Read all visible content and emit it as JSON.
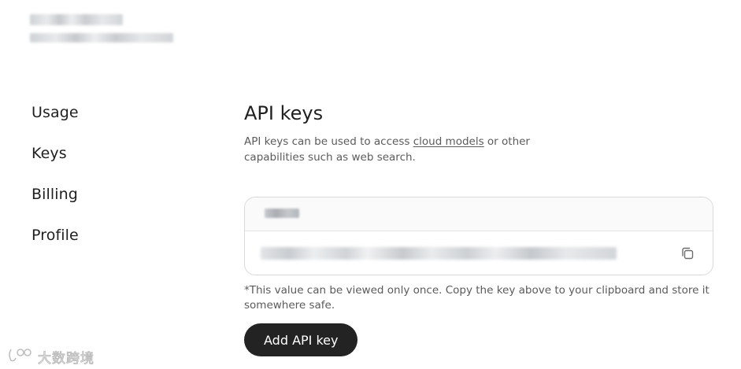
{
  "sidebar": {
    "items": [
      {
        "label": "Usage"
      },
      {
        "label": "Keys"
      },
      {
        "label": "Billing"
      },
      {
        "label": "Profile"
      }
    ]
  },
  "main": {
    "title": "API keys",
    "description_before": "API keys can be used to access ",
    "description_link": "cloud models",
    "description_after": " or other capabilities such as web search.",
    "note": "*This value can be viewed only once. Copy the key above to your clipboard and store it somewhere safe.",
    "add_button_label": "Add API key"
  },
  "watermark": {
    "text": "大数跨境"
  },
  "colors": {
    "button_bg": "#232323",
    "button_text": "#ffffff",
    "muted_text": "#5b5b5b",
    "card_border": "#d9d9d9"
  },
  "icons": {
    "copy": "copy-icon",
    "watermark_logo": "watermark-logo-icon"
  }
}
